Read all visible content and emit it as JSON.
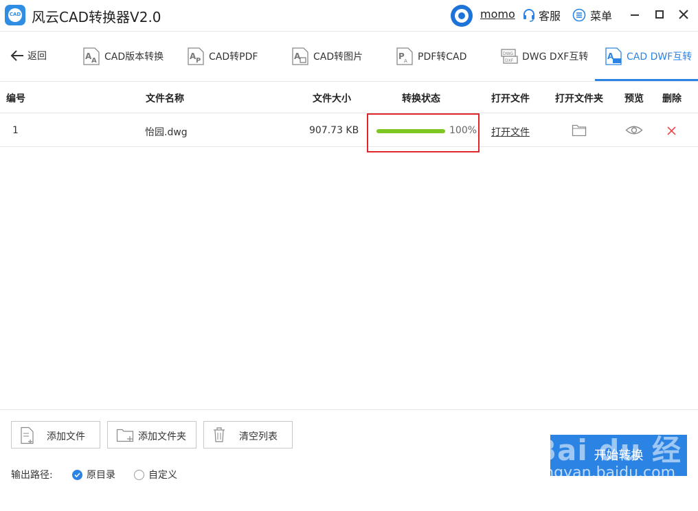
{
  "app": {
    "title": "风云CAD转换器V2.0",
    "logo_text": "CAD"
  },
  "header": {
    "username": "momo",
    "service_label": "客服",
    "menu_label": "菜单"
  },
  "toolbar": {
    "back_label": "返回",
    "tabs": [
      {
        "label": "CAD版本转换"
      },
      {
        "label": "CAD转PDF"
      },
      {
        "label": "CAD转图片"
      },
      {
        "label": "PDF转CAD"
      },
      {
        "label": "DWG DXF互转"
      },
      {
        "label": "CAD DWF互转",
        "active": true
      }
    ]
  },
  "table": {
    "headers": [
      "编号",
      "文件名称",
      "文件大小",
      "转换状态",
      "打开文件",
      "打开文件夹",
      "预览",
      "删除"
    ],
    "rows": [
      {
        "index": "1",
        "name": "怡园.dwg",
        "size": "907.73 KB",
        "progress": 100,
        "progress_text": "100%",
        "open_label": "打开文件"
      }
    ]
  },
  "bottom": {
    "add_file": "添加文件",
    "add_folder": "添加文件夹",
    "clear_list": "清空列表",
    "output_path_label": "输出路径:",
    "radio_original": "原目录",
    "radio_custom": "自定义",
    "start_label": "开始转换"
  },
  "watermark": {
    "line1": "Bai du 经验",
    "line2": "jingyan.baidu.com"
  },
  "colors": {
    "accent": "#2b84e4",
    "progress": "#7ec722",
    "highlight_border": "#e0262a",
    "delete": "#e84a4a"
  }
}
